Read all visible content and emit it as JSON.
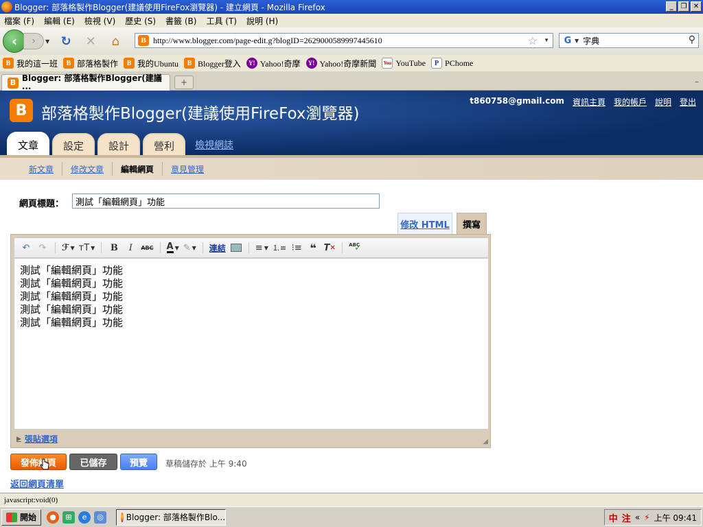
{
  "window": {
    "title": "Blogger: 部落格製作Blogger(建議使用FireFox瀏覽器) - 建立網頁 - Mozilla Firefox",
    "buttons": [
      "_",
      "❐",
      "✕"
    ]
  },
  "menu": [
    "檔案 (F)",
    "編輯 (E)",
    "檢視 (V)",
    "歷史 (S)",
    "書籤 (B)",
    "工具 (T)",
    "說明 (H)"
  ],
  "address": {
    "url": "http://www.blogger.com/page-edit.g?blogID=2629000589997445610"
  },
  "search": {
    "engine_icon": "google-icon",
    "value": "字典"
  },
  "bookmarks": [
    {
      "label": "我的這一班",
      "icon": "blogger-icon"
    },
    {
      "label": "部落格製作",
      "icon": "blogger-icon"
    },
    {
      "label": "我的Ubuntu",
      "icon": "blogger-icon"
    },
    {
      "label": "Blogger登入",
      "icon": "blogger-icon"
    },
    {
      "label": "Yahoo!奇摩",
      "icon": "yahoo-icon"
    },
    {
      "label": "Yahoo!奇摩新聞",
      "icon": "yahoo-icon"
    },
    {
      "label": "YouTube",
      "icon": "youtube-icon"
    },
    {
      "label": "PChome",
      "icon": "pchome-icon"
    }
  ],
  "tab": {
    "label": "Blogger: 部落格製作Blogger(建議···"
  },
  "blogger": {
    "logo": "B",
    "blog_title": "部落格製作Blogger(建議使用FireFox瀏覽器)",
    "email": "t860758@gmail.com",
    "account_links": [
      "資訊主頁",
      "我的帳戶",
      "說明",
      "登出"
    ],
    "main_tabs": [
      "文章",
      "設定",
      "設計",
      "營利"
    ],
    "view_blog": "檢視網誌",
    "sub_tabs": [
      "新文章",
      "修改文章",
      "編輯網頁",
      "意見管理"
    ]
  },
  "editor": {
    "title_label": "網頁標題：",
    "title_value": "測試「編輯網頁」功能",
    "mode_html": "修改 HTML",
    "mode_compose": "撰寫",
    "toolbar": {
      "link": "連結",
      "font": "ℱ",
      "size": "тT",
      "bold": "B",
      "italic": "I",
      "strike": "ABC",
      "text_color": "A",
      "check": "ABC"
    },
    "body_lines": [
      "測試「編輯網頁」功能",
      "測試「編輯網頁」功能",
      "測試「編輯網頁」功能",
      "測試「編輯網頁」功能",
      "測試「編輯網頁」功能"
    ],
    "paste_options": "張貼選項"
  },
  "actions": {
    "publish": "發佈網頁",
    "saved": "已儲存",
    "preview": "預覽",
    "draft_status": "草稿儲存於 上午 9:40",
    "back_link": "返回網頁清單"
  },
  "status": {
    "text": "javascript:void(0)"
  },
  "taskbar": {
    "start": "開始",
    "task": "Blogger: 部落格製作Blo...",
    "ime1": "中",
    "ime2": "注",
    "clock": "上午 09:41"
  }
}
